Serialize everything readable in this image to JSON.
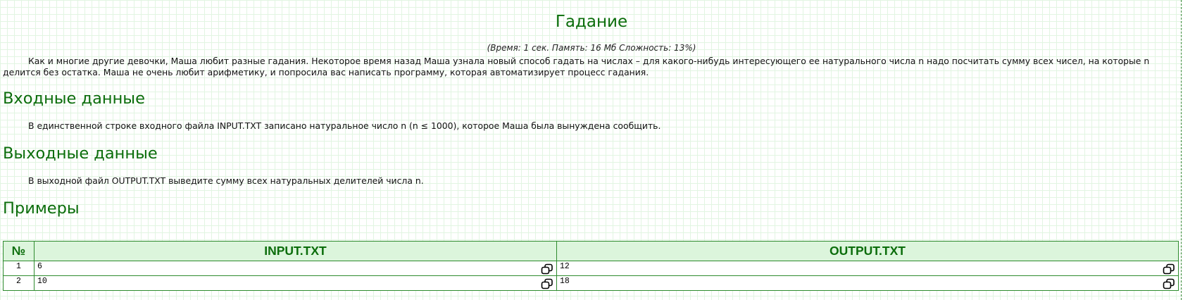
{
  "problem": {
    "title": "Гадание",
    "limits": "(Время: 1 сек. Память: 16 Мб Сложность: 13%)",
    "statement": "Как и многие другие девочки, Маша любит разные гадания. Некоторое время назад Маша узнала новый способ гадать на числах – для какого-нибудь интересующего ее натурального числа n надо посчитать сумму всех чисел, на которые n делится без остатка. Маша не очень любит арифметику, и попросила вас написать программу, которая автоматизирует процесс гадания."
  },
  "input_section": {
    "heading": "Входные данные",
    "text": "В единственной строке входного файла INPUT.TXT записано натуральное число n (n ≤ 1000), которое Маша была вынуждена сообщить."
  },
  "output_section": {
    "heading": "Выходные данные",
    "text": "В выходной файл OUTPUT.TXT выведите сумму всех натуральных делителей числа n."
  },
  "examples": {
    "heading": "Примеры",
    "columns": [
      "№",
      "INPUT.TXT",
      "OUTPUT.TXT"
    ],
    "rows": [
      {
        "num": "1",
        "input": "6",
        "output": "12"
      },
      {
        "num": "2",
        "input": "10",
        "output": "18"
      }
    ]
  },
  "colors": {
    "heading_green": "#0b6d0b",
    "table_header_bg": "#dcf5dc",
    "table_border": "#2e8b2e",
    "grid_line": "#e2f5e2"
  },
  "icons": {
    "copy": "copy-icon"
  }
}
